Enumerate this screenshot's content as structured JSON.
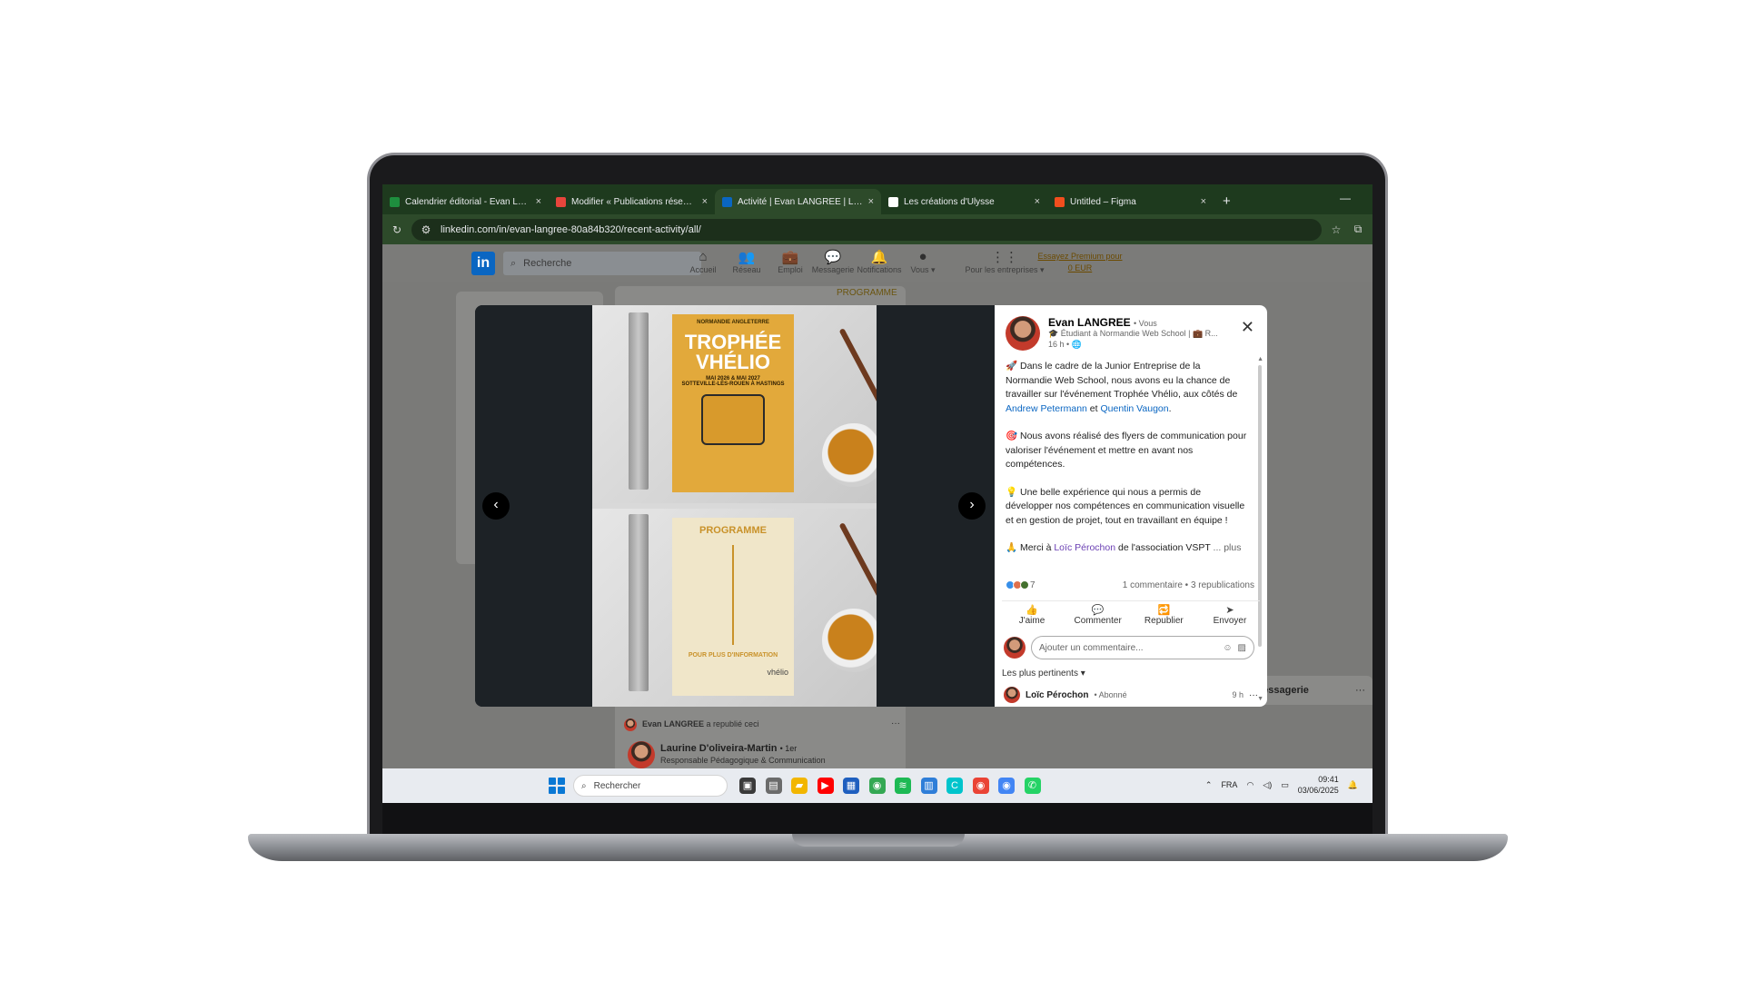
{
  "browser": {
    "tabs": [
      {
        "title": "Calendrier éditorial - Evan LANGREE",
        "favicon_color": "#1e8e3e",
        "active": false
      },
      {
        "title": "Modifier « Publications réseaux sociaux",
        "favicon_color": "#e8453c",
        "active": false
      },
      {
        "title": "Activité | Evan LANGREE | LinkedIn",
        "favicon_color": "#0a66c2",
        "active": true
      },
      {
        "title": "Les créations d'Ulysse",
        "favicon_color": "#ffffff",
        "active": false
      },
      {
        "title": "Untitled – Figma",
        "favicon_color": "#f24e1e",
        "active": false
      }
    ],
    "tab_close": "×",
    "new_tab": "+",
    "minimize": "—",
    "url": "linkedin.com/in/evan-langree-80a84b320/recent-activity/all/"
  },
  "linkedin_nav": {
    "logo": "in",
    "search_placeholder": "Recherche",
    "items": [
      {
        "label": "Accueil",
        "icon": "home-icon",
        "glyph": "⌂"
      },
      {
        "label": "Réseau",
        "icon": "network-icon",
        "glyph": "👥"
      },
      {
        "label": "Emploi",
        "icon": "briefcase-icon",
        "glyph": "💼"
      },
      {
        "label": "Messagerie",
        "icon": "message-icon",
        "glyph": "💬"
      },
      {
        "label": "Notifications",
        "icon": "bell-icon",
        "glyph": "🔔"
      },
      {
        "label": "Vous ▾",
        "icon": "profile-icon",
        "glyph": "●"
      },
      {
        "label": "Pour les entreprises ▾",
        "icon": "grid-icon",
        "glyph": "⋮⋮"
      }
    ],
    "premium": "Essayez Premium pour 0 EUR"
  },
  "background_feed": {
    "programme_tag": "PROGRAMME",
    "republished_line_name": "Evan LANGREE",
    "republished_line_text": "a republié ceci",
    "next_author": "Laurine D'oliveira-Martin",
    "next_author_degree": "• 1er",
    "next_author_title": "Responsable Pédagogique & Communication",
    "messaging_label": "Messagerie",
    "more": "···"
  },
  "post": {
    "author_name": "Evan LANGREE",
    "author_badge": "• Vous",
    "author_subtitle": "🎓 Étudiant à Normandie Web School | 💼 R...",
    "time": "16 h • 🌐",
    "paragraph1_prefix": "🚀 Dans le cadre de la Junior Entreprise de la Normandie Web School, nous avons eu la chance de travailler sur l'événement Trophée Vhélio, aux côtés de ",
    "mention1": "Andrew Petermann",
    "and": " et ",
    "mention2": "Quentin Vaugon",
    "period": ".",
    "paragraph2": "🎯 Nous avons réalisé des flyers de communication pour valoriser l'événement et mettre en avant nos compétences.",
    "paragraph3": "💡 Une belle expérience qui nous a permis de développer nos compétences en communication visuelle et en gestion de projet, tout en travaillant en équipe !",
    "thanks_prefix": "🙏 Merci à ",
    "mention3": "Loïc Pérochon",
    "thanks_suffix": " de l'association VSPT",
    "more": "... plus",
    "reactions_count": "7",
    "comments_reposts": "1 commentaire • 3 republications",
    "actions": [
      {
        "label": "J'aime",
        "icon": "like-icon",
        "glyph": "👍"
      },
      {
        "label": "Commenter",
        "icon": "comment-icon",
        "glyph": "💬"
      },
      {
        "label": "Republier",
        "icon": "repost-icon",
        "glyph": "🔁"
      },
      {
        "label": "Envoyer",
        "icon": "send-icon",
        "glyph": "➤"
      }
    ],
    "comment_placeholder": "Ajouter un commentaire...",
    "sort_label": "Les plus pertinents ▾",
    "first_comment_author": "Loïc Pérochon",
    "first_comment_badge": "• Abonné",
    "first_comment_time": "9 h",
    "first_comment_more": "···",
    "close": "✕"
  },
  "media": {
    "prev": "‹",
    "next": "›",
    "flyer1_top": "NORMANDIE ANGLETERRE",
    "flyer1_title_line1": "TROPHÉE",
    "flyer1_title_line2": "VHÉLIO",
    "flyer1_dates": "MAI 2026 & MAI 2027",
    "flyer1_places": "SOTTEVILLE-LÈS-ROUEN À HASTINGS",
    "flyer2_title": "PROGRAMME",
    "flyer2_footer": "POUR PLUS D'INFORMATION",
    "flyer2_brand": "vhélio"
  },
  "taskbar": {
    "search_placeholder": "Rechercher",
    "language": "FRA",
    "time": "09:41",
    "date": "03/06/2025",
    "apps": [
      {
        "name": "task-view-icon",
        "color": "#3a3a3a",
        "glyph": "▣"
      },
      {
        "name": "notepad-icon",
        "color": "#6b6b6b",
        "glyph": "▤"
      },
      {
        "name": "file-explorer-icon",
        "color": "#f2b600",
        "glyph": "▰"
      },
      {
        "name": "youtube-icon",
        "color": "#ff0000",
        "glyph": "▶"
      },
      {
        "name": "store-icon",
        "color": "#1f5fbf",
        "glyph": "▦"
      },
      {
        "name": "chrome-icon",
        "color": "#34a853",
        "glyph": "◉"
      },
      {
        "name": "spotify-icon",
        "color": "#1db954",
        "glyph": "≋"
      },
      {
        "name": "notes-icon",
        "color": "#2f7ed8",
        "glyph": "▥"
      },
      {
        "name": "canva-icon",
        "color": "#00c4cc",
        "glyph": "C"
      },
      {
        "name": "chrome-profile-icon",
        "color": "#ea4335",
        "glyph": "◉"
      },
      {
        "name": "chrome-profile2-icon",
        "color": "#4285f4",
        "glyph": "◉"
      },
      {
        "name": "whatsapp-icon",
        "color": "#25d366",
        "glyph": "✆"
      }
    ]
  }
}
